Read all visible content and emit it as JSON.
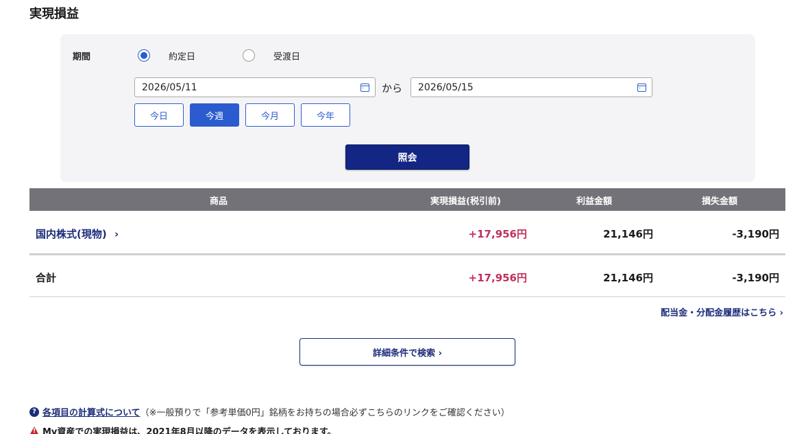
{
  "page_title": "実現損益",
  "filter": {
    "period_label": "期間",
    "radio_options": [
      {
        "label": "約定日",
        "checked": true
      },
      {
        "label": "受渡日",
        "checked": false
      }
    ],
    "date_from": "2026/05/11",
    "date_separator": "から",
    "date_to": "2026/05/15",
    "quick_buttons": [
      {
        "label": "今日",
        "active": false
      },
      {
        "label": "今週",
        "active": true
      },
      {
        "label": "今月",
        "active": false
      },
      {
        "label": "今年",
        "active": false
      }
    ],
    "submit_label": "照会"
  },
  "table": {
    "headers": [
      "商品",
      "実現損益(税引前)",
      "利益金額",
      "損失金額"
    ],
    "rows": [
      {
        "product": "国内株式(現物)",
        "chevron": "›",
        "realized": "+17,956円",
        "profit": "21,146円",
        "loss": "-3,190円"
      }
    ],
    "total": {
      "label": "合計",
      "realized": "+17,956円",
      "profit": "21,146円",
      "loss": "-3,190円"
    }
  },
  "history_link": "配当金・分配金履歴はこちら ›",
  "detail_search_label": "詳細条件で検索 ›",
  "help": {
    "icon": "?",
    "link_text": "各項目の計算式について",
    "note": "（※一般預りで「参考単価0円」銘柄をお持ちの場合必ずこちらのリンクをご確認ください）"
  },
  "warning": {
    "text": "My資産での実現損益は、2021年8月以降のデータを表示しております。"
  },
  "colors": {
    "accent": "#2a5ccf",
    "navy": "#132684",
    "profit": "#c0305a",
    "header_bg": "#727278"
  }
}
